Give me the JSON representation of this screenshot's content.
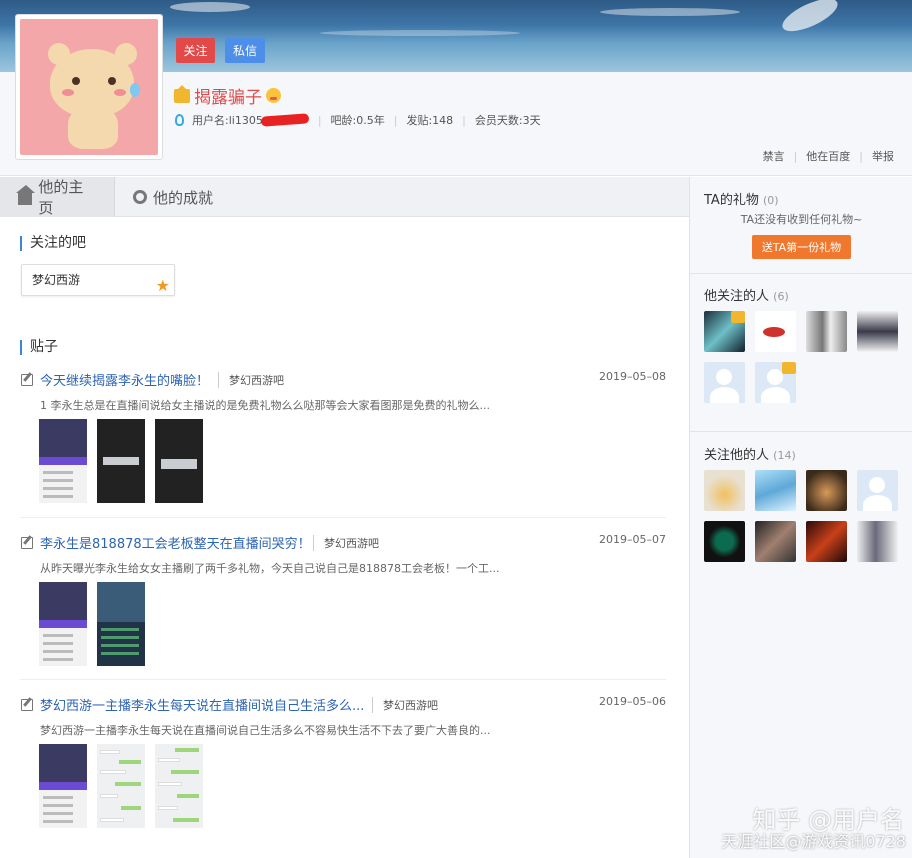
{
  "header": {
    "follow_label": "关注",
    "message_label": "私信",
    "username": "揭露骗子",
    "meta": {
      "account_label": "用户名:li1305",
      "age_label": "吧龄:0.5年",
      "posts_label": "发贴:148",
      "member_days_label": "会员天数:3天"
    },
    "links": [
      "禁言",
      "他在百度",
      "举报"
    ]
  },
  "tabs": [
    {
      "label": "他的主页",
      "icon": "home-icon",
      "active": true
    },
    {
      "label": "他的成就",
      "icon": "medal-icon",
      "active": false
    }
  ],
  "followed_forums": {
    "title": "关注的吧",
    "items": [
      {
        "name": "梦幻西游",
        "icon": "star-icon"
      }
    ]
  },
  "posts_section": {
    "title": "贴子",
    "posts": [
      {
        "title": "今天继续揭露李永生的嘴脸！",
        "forum": "梦幻西游吧",
        "date": "2019–05–08",
        "excerpt": "1 李永生总是在直播间说给女主播说的是免费礼物么么哒那等会大家看图那是免费的礼物么..."
      },
      {
        "title": "李永生是818878工会老板整天在直播间哭穷！",
        "forum": "梦幻西游吧",
        "date": "2019–05–07",
        "excerpt": "从昨天曝光李永生给女女主播刷了两千多礼物，今天自己说自己是818878工会老板！一个工..."
      },
      {
        "title": "梦幻西游一主播李永生每天说在直播间说自己生活多么...",
        "forum": "梦幻西游吧",
        "date": "2019–05–06",
        "excerpt": "梦幻西游一主播李永生每天说在直播间说自己生活多么不容易快生活不下去了要广大善良的..."
      }
    ]
  },
  "sidebar": {
    "gifts": {
      "title": "TA的礼物",
      "count": "(0)",
      "empty_text": "TA还没有收到任何礼物~",
      "button_label": "送TA第一份礼物"
    },
    "following": {
      "title": "他关注的人",
      "count": "(6)"
    },
    "followers": {
      "title": "关注他的人",
      "count": "(14)"
    }
  },
  "watermark": {
    "line1": "知乎 @用户名",
    "line2": "天涯社区@游戏资讯0728"
  }
}
